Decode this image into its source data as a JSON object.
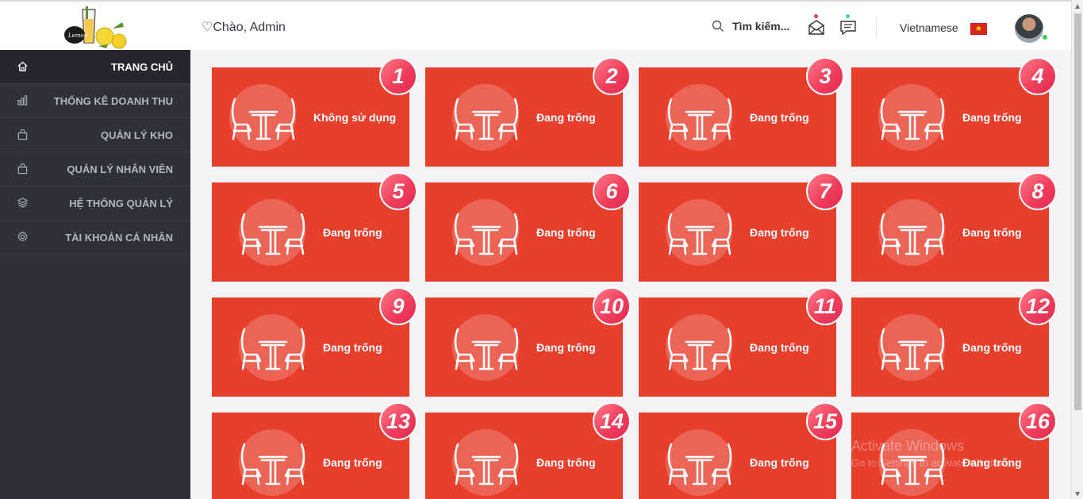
{
  "header": {
    "greeting": "Chào, Admin",
    "search_label": "Tìm kiếm...",
    "language": "Vietnamese",
    "flag_icon": "vietnam-flag-icon",
    "mail_dot_color": "#e8356a",
    "chat_dot_color": "#3ed1b5"
  },
  "sidebar": {
    "items": [
      {
        "label": "TRANG CHỦ",
        "icon": "home-icon",
        "active": true
      },
      {
        "label": "THỐNG KÊ DOANH THU",
        "icon": "bar-chart-icon",
        "active": false
      },
      {
        "label": "QUẢN LÝ KHO",
        "icon": "bag-icon",
        "active": false
      },
      {
        "label": "QUẢN LÝ NHÂN VIÊN",
        "icon": "bag-icon",
        "active": false
      },
      {
        "label": "HỆ THỐNG QUẢN LÝ",
        "icon": "layers-icon",
        "active": false
      },
      {
        "label": "TÀI KHOẢN CÁ NHÂN",
        "icon": "gear-icon",
        "active": false
      }
    ]
  },
  "tables": [
    {
      "number": "1",
      "status": "Không sử dụng"
    },
    {
      "number": "2",
      "status": "Đang trống"
    },
    {
      "number": "3",
      "status": "Đang trống"
    },
    {
      "number": "4",
      "status": "Đang trống"
    },
    {
      "number": "5",
      "status": "Đang trống"
    },
    {
      "number": "6",
      "status": "Đang trống"
    },
    {
      "number": "7",
      "status": "Đang trống"
    },
    {
      "number": "8",
      "status": "Đang trống"
    },
    {
      "number": "9",
      "status": "Đang trống"
    },
    {
      "number": "10",
      "status": "Đang trống"
    },
    {
      "number": "11",
      "status": "Đang trống"
    },
    {
      "number": "12",
      "status": "Đang trống"
    },
    {
      "number": "13",
      "status": "Đang trống"
    },
    {
      "number": "14",
      "status": "Đang trống"
    },
    {
      "number": "15",
      "status": "Đang trống"
    },
    {
      "number": "16",
      "status": "Đang trống"
    }
  ],
  "watermark": {
    "title": "Activate Windows",
    "subtitle": "Go to Settings to activate Windows."
  },
  "colors": {
    "card": "#e83e2c",
    "sidebar": "#2f3038",
    "badge": "#f03e5c"
  }
}
